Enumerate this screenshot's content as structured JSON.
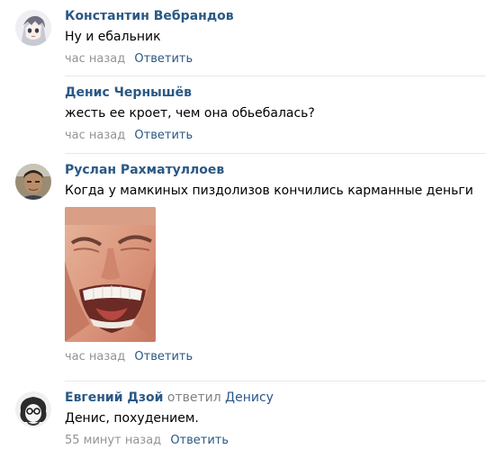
{
  "comments": [
    {
      "author": "Константин Вебрандов",
      "reply_to": "",
      "reply_target": "",
      "text": "Ну и ебальник",
      "time": "час назад",
      "reply_label": "Ответить",
      "avatar": "anime-avatar",
      "has_avatar": true
    },
    {
      "author": "Денис Чернышёв",
      "reply_to": "",
      "reply_target": "",
      "text": "жесть ее кроет, чем она обьебалась?",
      "time": "час назад",
      "reply_label": "Ответить",
      "has_avatar": false
    },
    {
      "author": "Руслан Рахматуллоев",
      "reply_to": "",
      "reply_target": "",
      "text": "Когда у мамкиных пиздолизов кончились карманные деньги",
      "time": "час назад",
      "reply_label": "Ответить",
      "avatar": "photo-avatar",
      "has_avatar": true,
      "attachment": "laughing-face-photo"
    },
    {
      "author": "Евгений Дзой",
      "reply_to": "ответил",
      "reply_target": "Денису",
      "text": "Денис, похудением.",
      "time": "55 минут назад",
      "reply_label": "Ответить",
      "avatar": "sketch-avatar",
      "has_avatar": true
    }
  ],
  "colors": {
    "link": "#2a5885",
    "muted": "#939393",
    "divider": "#e7e8ec"
  }
}
